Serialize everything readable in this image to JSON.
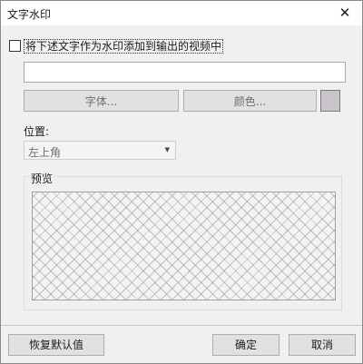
{
  "window": {
    "title": "文字水印",
    "close_glyph": "✕"
  },
  "checkbox": {
    "label": "将下述文字作为水印添加到输出的视频中",
    "checked": false
  },
  "watermark_text": {
    "value": "",
    "placeholder": ""
  },
  "buttons": {
    "font": "字体...",
    "color": "颜色...",
    "restore": "恢复默认值",
    "ok": "确定",
    "cancel": "取消"
  },
  "color_swatch": {
    "color": "#c9c4c9"
  },
  "position": {
    "label": "位置:",
    "selected": "左上角"
  },
  "preview": {
    "label": "预览"
  }
}
